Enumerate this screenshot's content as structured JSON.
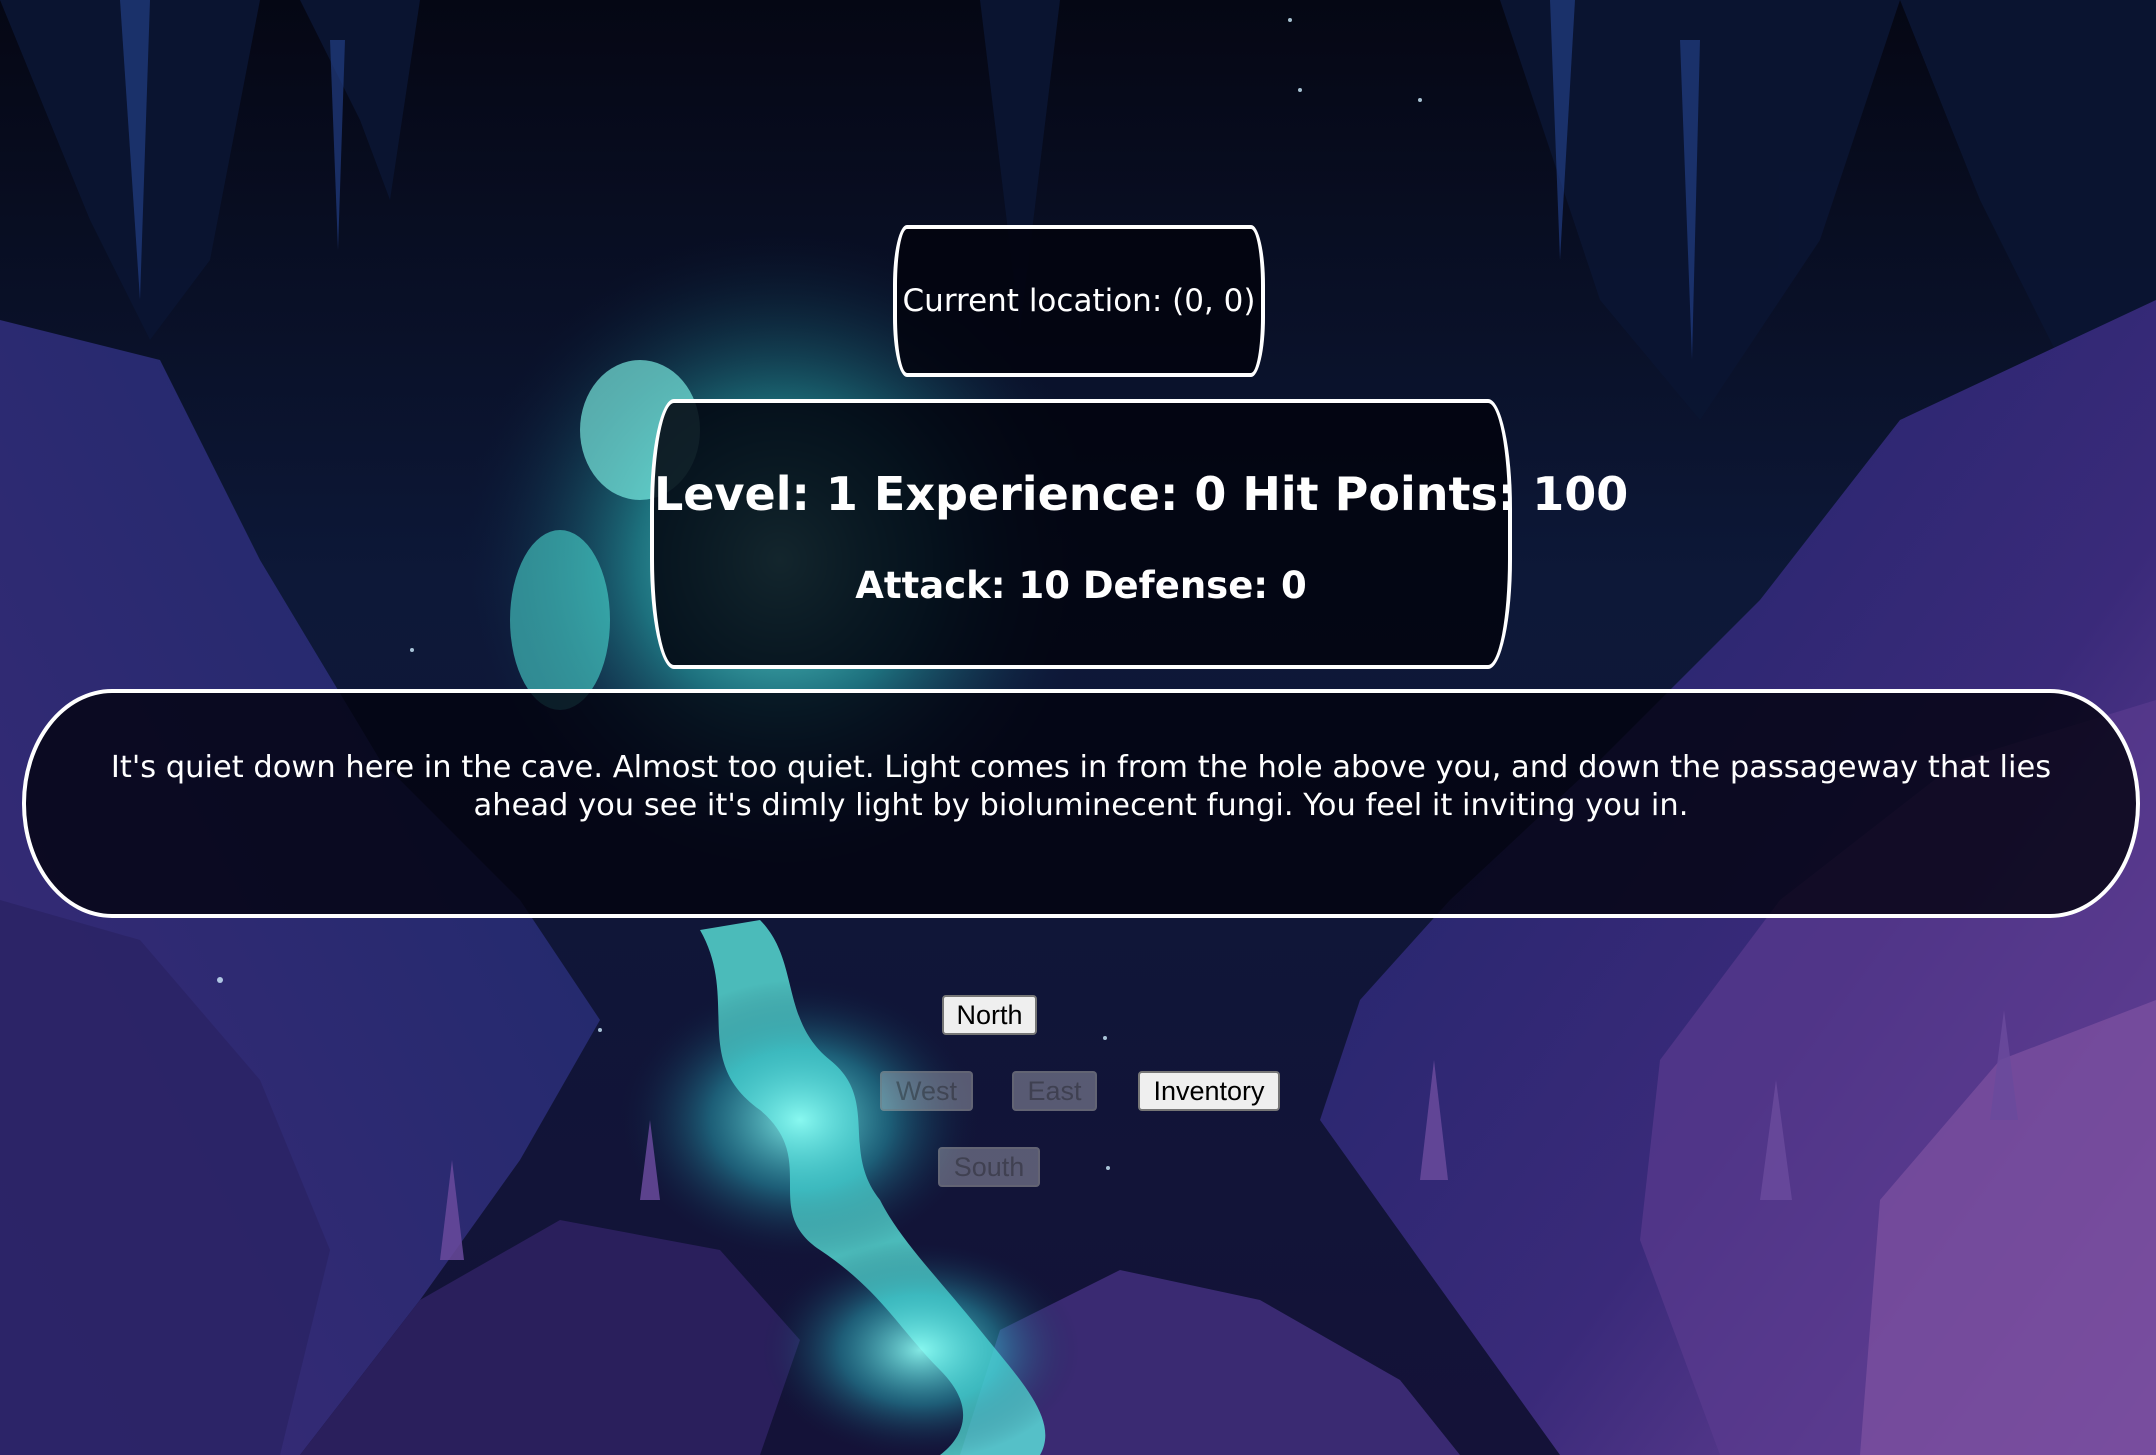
{
  "location": {
    "text": "Current location: (0, 0)"
  },
  "stats": {
    "line1": "Level: 1 Experience: 0 Hit Points: 100",
    "line2": "Attack: 10 Defense: 0"
  },
  "narrative": {
    "text": "It's quiet down here in the cave. Almost too quiet. Light comes in from the hole above you, and down the passageway that lies ahead you see it's dimly light by bioluminecent fungi. You feel it inviting you in."
  },
  "controls": {
    "north": {
      "label": "North",
      "enabled": true
    },
    "west": {
      "label": "West",
      "enabled": false
    },
    "east": {
      "label": "East",
      "enabled": false
    },
    "inventory": {
      "label": "Inventory",
      "enabled": true
    },
    "south": {
      "label": "South",
      "enabled": false
    }
  },
  "theme": {
    "panel_border": "#ffffff",
    "panel_background": "#02030e",
    "text": "#ffffff",
    "cave_teal": "#5ff3e6",
    "cave_purple": "#9a56c9",
    "cave_navy": "#0c0f2c"
  }
}
